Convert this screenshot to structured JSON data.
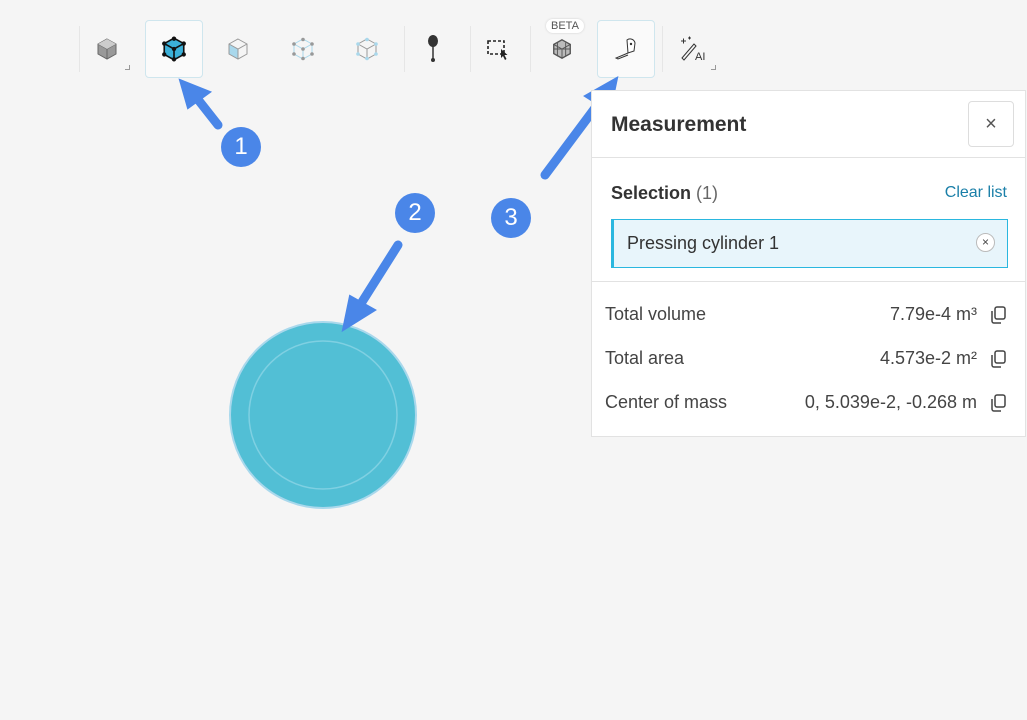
{
  "toolbar": {
    "beta_label": "BETA",
    "ai_label": "AI"
  },
  "panel": {
    "title": "Measurement",
    "close_label": "×",
    "selection_label": "Selection",
    "selection_count": "(1)",
    "clear_list": "Clear list",
    "selected_item": "Pressing cylinder 1",
    "remove_label": "×",
    "rows": [
      {
        "label": "Total volume",
        "value": "7.79e-4 m³"
      },
      {
        "label": "Total area",
        "value": "4.573e-2 m²"
      },
      {
        "label": "Center of mass",
        "value": "0, 5.039e-2, -0.268 m"
      }
    ]
  },
  "annotations": {
    "step1": "1",
    "step2": "2",
    "step3": "3"
  },
  "colors": {
    "accent": "#2ab7df",
    "annotation": "#4a86e8",
    "cylinder": "#52bfd5",
    "link": "#1a7fa8"
  }
}
